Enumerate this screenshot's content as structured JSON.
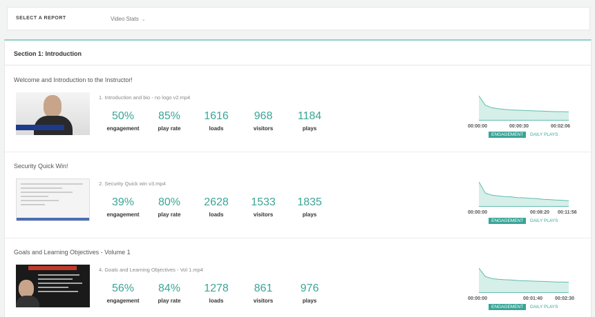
{
  "report": {
    "label": "SELECT A REPORT",
    "selected": "Video Stats"
  },
  "section": {
    "title": "Section 1: Introduction"
  },
  "videos": [
    {
      "title": "Welcome and Introduction to the Instructor!",
      "file": "1. Introduction and bio - no logo v2.mp4",
      "engagement": "50%",
      "play_rate": "85%",
      "loads": "1616",
      "visitors": "968",
      "plays": "1184",
      "time_start": "00:00:00",
      "time_mid": "00:00:30",
      "time_end": "00:02:06",
      "curve": [
        1.0,
        0.62,
        0.52,
        0.48,
        0.45,
        0.43,
        0.42,
        0.41,
        0.4,
        0.39,
        0.38,
        0.37,
        0.36,
        0.36,
        0.35
      ]
    },
    {
      "title": "Security Quick Win!",
      "file": "2. Security Quick win v3.mp4",
      "engagement": "39%",
      "play_rate": "80%",
      "loads": "2628",
      "visitors": "1533",
      "plays": "1835",
      "time_start": "00:00:00",
      "time_mid": "00:08:20",
      "time_end": "00:11:56",
      "curve": [
        1.0,
        0.55,
        0.47,
        0.44,
        0.41,
        0.4,
        0.37,
        0.36,
        0.34,
        0.33,
        0.3,
        0.29,
        0.27,
        0.26,
        0.24
      ]
    },
    {
      "title": "Goals and Learning Objectives - Volume 1",
      "file": "4. Goals and Learning Objectives - Vol 1.mp4",
      "engagement": "56%",
      "play_rate": "84%",
      "loads": "1278",
      "visitors": "861",
      "plays": "976",
      "time_start": "00:00:00",
      "time_mid": "00:01:40",
      "time_end": "00:02:30",
      "curve": [
        1.0,
        0.66,
        0.58,
        0.55,
        0.53,
        0.52,
        0.5,
        0.49,
        0.48,
        0.47,
        0.46,
        0.45,
        0.44,
        0.44,
        0.43
      ]
    }
  ],
  "labels": {
    "engagement": "engagement",
    "play_rate": "play rate",
    "loads": "loads",
    "visitors": "visitors",
    "plays": "plays",
    "tab_engagement": "ENGAGEMENT",
    "tab_daily": "DAILY PLAYS"
  },
  "colors": {
    "accent": "#3aa597",
    "fill": "#d6efe9",
    "line": "#5fbcae"
  }
}
